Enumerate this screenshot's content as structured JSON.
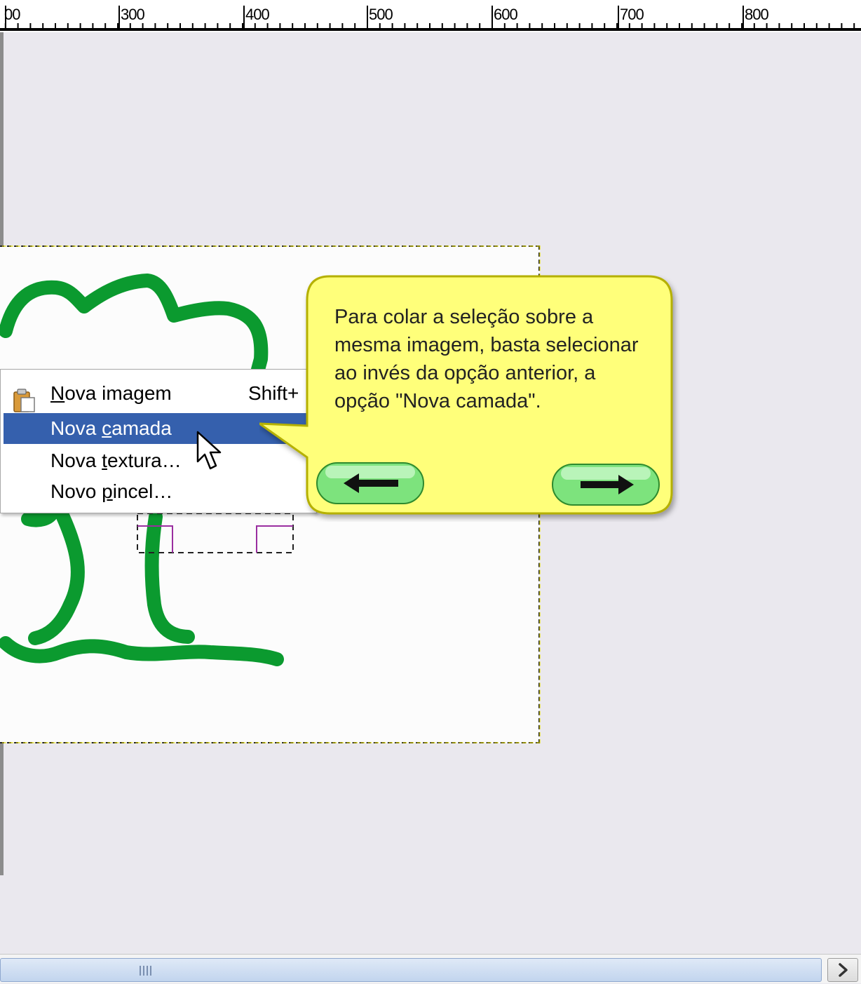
{
  "ruler": {
    "labels": [
      "00",
      "300",
      "400",
      "500",
      "600",
      "700",
      "800"
    ]
  },
  "context_menu": {
    "items": [
      {
        "label": "Nova imagem",
        "mnemonic": "N",
        "accelerator": "Shift+",
        "icon": "paste-clipboard-icon",
        "state": "normal"
      },
      {
        "label": "Nova camada",
        "mnemonic": "c",
        "accelerator": "",
        "icon": "",
        "state": "highlighted"
      },
      {
        "label": "Nova textura…",
        "mnemonic": "t",
        "accelerator": "",
        "icon": "",
        "state": "normal"
      },
      {
        "label": "Novo pincel…",
        "mnemonic": "p",
        "accelerator": "",
        "icon": "",
        "state": "normal"
      }
    ],
    "highlight_color": "#3560ad"
  },
  "callout": {
    "text": "Para colar a seleção sobre a mesma imagem, basta selecionar ao invés da opção anterior, a opção \"Nova camada\".",
    "background_color": "#ffff7a",
    "prev_button_icon": "arrow-left-icon",
    "next_button_icon": "arrow-right-icon",
    "button_color": "#7de37d"
  },
  "canvas": {
    "background_color": "#eae8ee",
    "image_background_color": "#fcfcfc",
    "drawing_color": "#0b9a2f",
    "selection_border_color": "#e8e000"
  },
  "scrollbar": {
    "grip_icon": "scroll-grip-icon",
    "right_arrow_icon": "chevron-right-icon"
  }
}
